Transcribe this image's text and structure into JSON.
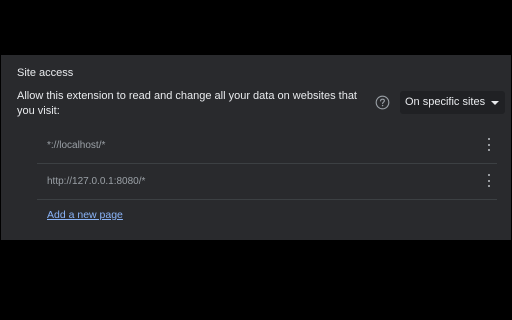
{
  "site_access": {
    "title": "Site access",
    "description": "Allow this extension to read and change all your data on websites that you visit:",
    "help_icon": "help-circle-icon",
    "dropdown": {
      "selected": "On specific sites",
      "icon": "dropdown-arrow-icon"
    },
    "sites": [
      {
        "pattern": "*://localhost/*"
      },
      {
        "pattern": "http://127.0.0.1:8080/*"
      }
    ],
    "more_icon": "more-vertical-icon",
    "add_link": "Add a new page"
  },
  "colors": {
    "panel_bg": "#292a2d",
    "text_primary": "#e8eaed",
    "text_secondary": "#9aa0a6",
    "link": "#8ab4f8",
    "divider": "#3c4043"
  }
}
